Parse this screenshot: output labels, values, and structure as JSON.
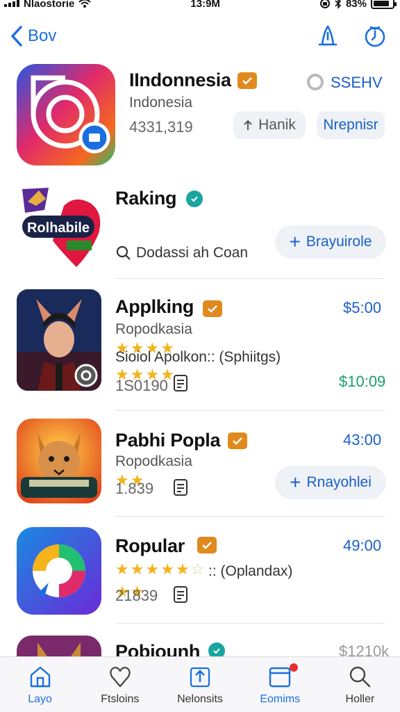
{
  "status_bar": {
    "carrier": "Nlaostorie",
    "time": "13:9M",
    "battery": "83%",
    "battery_level": 0.83
  },
  "nav": {
    "back_label": "Bov",
    "left_icon": "share-icon",
    "right_icon": "clock-icon"
  },
  "apps": [
    {
      "title": "IIndonnesia",
      "subtitle": "Indonesia",
      "count": "4331,319",
      "status_label": "SSEHV",
      "primary_action": "Hanik",
      "secondary_action": "Nrepnisr",
      "badge": "orange"
    },
    {
      "title": "Raking",
      "developer": "Dodassi ah Coan",
      "icon_text": "Rolhabile",
      "action": "Brayuirole",
      "badge": "verified"
    },
    {
      "title": "Applking",
      "subtitle": "Ropodkasia",
      "developer": "Sioiol Apolkon:: (Sphiitgs)",
      "count": "1S0190",
      "price_top": "$5:00",
      "price_bottom": "$10:09",
      "rating": 4,
      "badge": "orange"
    },
    {
      "title": "Pabhi Popla",
      "subtitle": "Ropodkasia",
      "count": "1.839",
      "price_top": "43:00",
      "action": "Rnayohlei",
      "rating": 2,
      "badge": "orange"
    },
    {
      "title": "Ropular",
      "developer": ":: (Oplandax)",
      "count": "21839",
      "price_top": "49:00",
      "rating": 4.5,
      "badge": "orange"
    },
    {
      "title": "Pobiounh",
      "price_top": "$1210k",
      "badge": "verified"
    }
  ],
  "tabs": [
    {
      "label": "Layo",
      "icon": "home-icon"
    },
    {
      "label": "Ftsloins",
      "icon": "heart-icon"
    },
    {
      "label": "Nelonsits",
      "icon": "upload-icon"
    },
    {
      "label": "Eomims",
      "icon": "inbox-icon"
    },
    {
      "label": "Holler",
      "icon": "search-icon"
    }
  ],
  "colors": {
    "accent": "#1a6fe0",
    "price_blue": "#1a5fc9",
    "price_green": "#1aa06a",
    "star": "#f2b41a",
    "badge_orange": "#e08a1e",
    "badge_verified": "#1aa5a0",
    "notification_dot": "#e53030"
  }
}
